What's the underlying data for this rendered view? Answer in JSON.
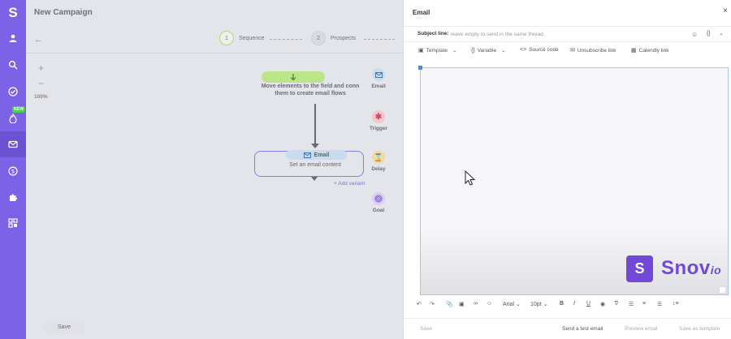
{
  "sidebar": {
    "logo": "S",
    "new_badge": "NEW",
    "items": [
      {
        "name": "profile-icon"
      },
      {
        "name": "search-icon"
      },
      {
        "name": "check-icon"
      },
      {
        "name": "flame-icon"
      },
      {
        "name": "mail-icon",
        "active": true
      },
      {
        "name": "dollar-icon"
      },
      {
        "name": "puzzle-icon"
      },
      {
        "name": "apps-icon"
      }
    ],
    "color": "#7b62e6"
  },
  "campaign": {
    "title": "New Campaign",
    "steps": [
      {
        "num": "1",
        "label": "Sequence"
      },
      {
        "num": "2",
        "label": "Prospects"
      }
    ],
    "zoom": {
      "plus": "+",
      "minus": "−",
      "value": "100%"
    },
    "drop_hint": "Move elements to the field and conn them to create email flows",
    "node": {
      "title": "Email",
      "content": "Set an email content"
    },
    "add_variant": "+ Add variant",
    "tools": [
      {
        "label": "Email",
        "icon": "email-icon"
      },
      {
        "label": "Trigger",
        "icon": "trigger-icon"
      },
      {
        "label": "Delay",
        "icon": "delay-icon"
      },
      {
        "label": "Goal",
        "icon": "goal-icon"
      }
    ],
    "save": "Save"
  },
  "email_panel": {
    "title": "Email",
    "close": "×",
    "subject_label": "Subject line:",
    "subject_placeholder": "leave empty to send in the same thread",
    "braces": "{}",
    "toolbar": {
      "template": "Template",
      "variable": "Variable",
      "source_code": "Source code",
      "unsubscribe": "Unsubscribe link",
      "calendly": "Calendly link"
    },
    "logo": {
      "letter": "S",
      "text": "Snov",
      "suffix": "io",
      "color": "#7248d6"
    },
    "format": {
      "font": "Arial",
      "size": "10pt"
    },
    "footer": {
      "save": "Save",
      "test": "Send a test email",
      "preview": "Preview email",
      "template": "Save as template"
    }
  }
}
